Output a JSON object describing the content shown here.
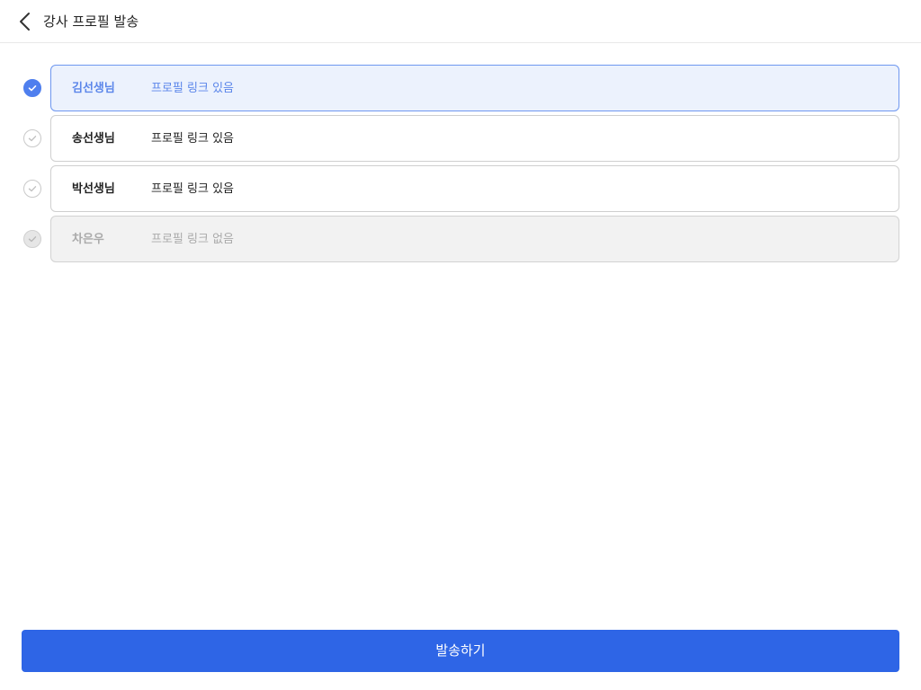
{
  "header": {
    "title": "강사 프로필 발송",
    "back_icon": "chevron-left-icon"
  },
  "instructors": [
    {
      "name": "김선생님",
      "status": "프로필 링크 있음",
      "state": "selected"
    },
    {
      "name": "송선생님",
      "status": "프로필 링크 있음",
      "state": "default"
    },
    {
      "name": "박선생님",
      "status": "프로필 링크 있음",
      "state": "default"
    },
    {
      "name": "차은우",
      "status": "프로필 링크 없음",
      "state": "disabled"
    }
  ],
  "footer": {
    "send_label": "발송하기"
  },
  "colors": {
    "accent": "#2e65e6",
    "selected_text": "#5b86ea",
    "selected_bg": "#ecf2fd",
    "disabled_text": "#aaaaaa"
  }
}
